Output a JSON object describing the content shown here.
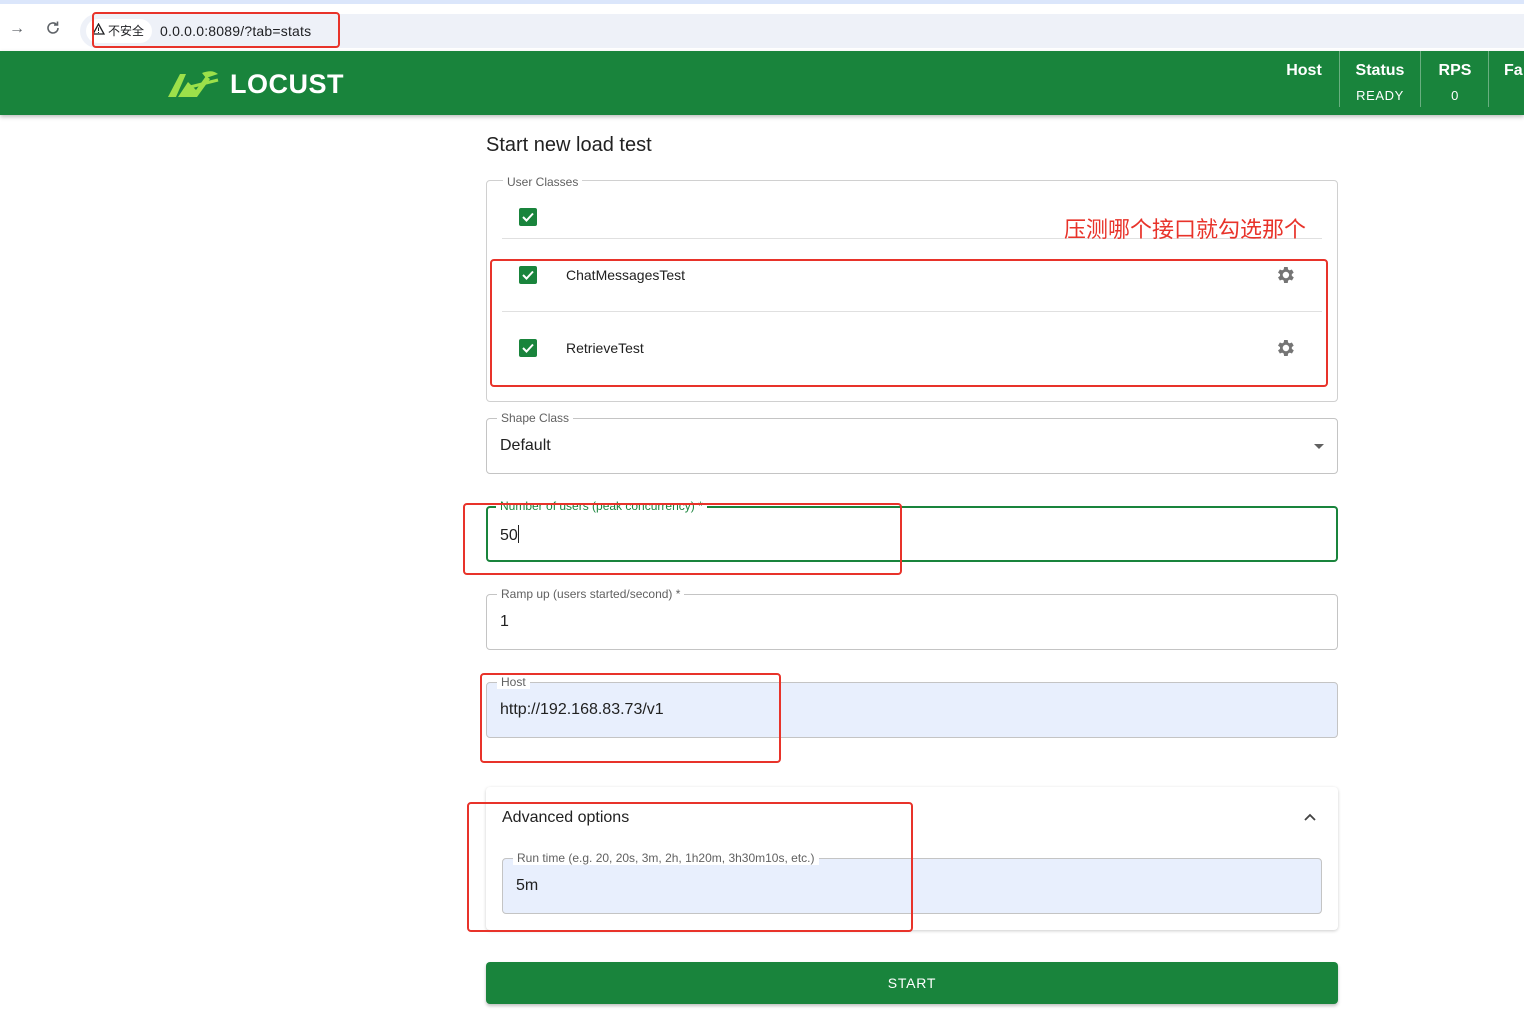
{
  "browser": {
    "security_label": "不安全",
    "url": "0.0.0.0:8089/?tab=stats"
  },
  "header": {
    "logo_text": "LOCUST",
    "stats": [
      {
        "label": "Host",
        "value": ""
      },
      {
        "label": "Status",
        "value": "READY"
      },
      {
        "label": "RPS",
        "value": "0"
      },
      {
        "label": "Fa",
        "value": ""
      }
    ],
    "accent_color": "#19843c"
  },
  "form": {
    "title": "Start new load test",
    "user_classes": {
      "legend": "User Classes",
      "select_all_checked": true,
      "items": [
        {
          "name": "ChatMessagesTest",
          "checked": true
        },
        {
          "name": "RetrieveTest",
          "checked": true
        }
      ]
    },
    "shape_class": {
      "legend": "Shape Class",
      "value": "Default"
    },
    "users": {
      "legend": "Number of users (peak concurrency) *",
      "value": "50"
    },
    "ramp_up": {
      "legend": "Ramp up (users started/second) *",
      "value": "1"
    },
    "host": {
      "legend": "Host",
      "value": "http://192.168.83.73/v1"
    },
    "advanced": {
      "title": "Advanced options",
      "run_time_legend": "Run time (e.g. 20, 20s, 3m, 2h, 1h20m, 3h30m10s, etc.)",
      "run_time_value": "5m"
    },
    "start_label": "START"
  },
  "annotation": {
    "text": "压测哪个接口就勾选那个",
    "color": "#e8332a"
  }
}
